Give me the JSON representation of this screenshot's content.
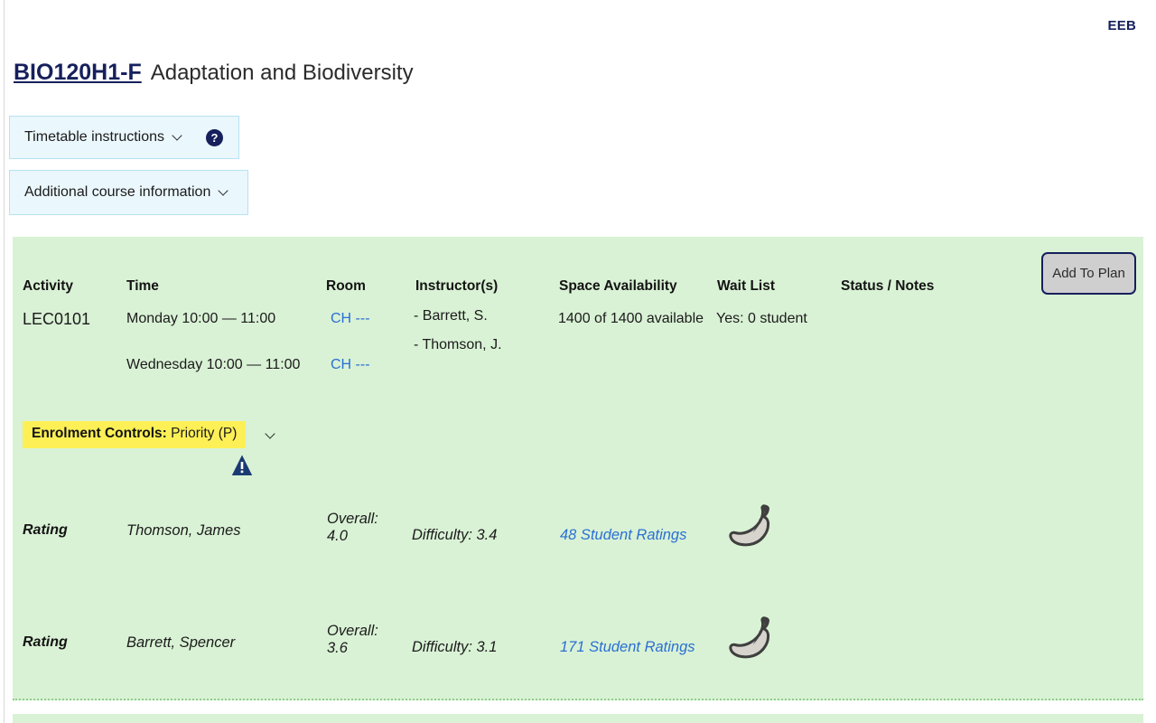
{
  "page": {
    "org_code": "EEB"
  },
  "course": {
    "code": "BIO120H1-F",
    "name": "Adaptation and Biodiversity"
  },
  "panels": [
    {
      "label": "Timetable instructions",
      "chevron": "chevron-down-icon",
      "help": "?"
    },
    {
      "label": "Additional course information",
      "chevron": "chevron-down-icon"
    }
  ],
  "meeting_table": {
    "headers": {
      "activity": "Activity",
      "time": "Time",
      "room": "Room",
      "instructors": "Instructor(s)",
      "space": "Space Availability",
      "waitlist": "Wait List",
      "status": "Status / Notes"
    },
    "row": {
      "activity": "LEC0101",
      "times": [
        "Monday 10:00 — 11:00",
        "Wednesday 10:00 — 11:00"
      ],
      "rooms": [
        "CH ---",
        "CH ---"
      ],
      "instructors": [
        "- Barrett, S.",
        "- Thomson, J."
      ],
      "space": "1400 of 1400 available",
      "waitlist": "Yes: 0 student",
      "status": ""
    },
    "add_to_plan": "Add To Plan"
  },
  "enrolment": {
    "label": "Enrolment Controls:",
    "value": "Priority (P)",
    "chevron": "chevron-down-icon",
    "warning": "warning-triangle-icon"
  },
  "ratings": [
    {
      "label": "Rating",
      "instructor": "Thomson, James",
      "overall": "Overall: 4.0",
      "difficulty": "Difficulty: 3.4",
      "student_ratings": "48 Student Ratings",
      "chili": "chili-pepper-icon"
    },
    {
      "label": "Rating",
      "instructor": "Barrett, Spencer",
      "overall": "Overall: 3.6",
      "difficulty": "Difficulty: 3.1",
      "student_ratings": "171 Student Ratings",
      "chili": "chili-pepper-icon"
    }
  ],
  "colors": {
    "navy": "#16205c",
    "section_green": "#d9f2d5",
    "panel_blue": "#eaf7fd",
    "highlight_yellow": "#fdf056",
    "link_blue": "#2a6fd4"
  }
}
